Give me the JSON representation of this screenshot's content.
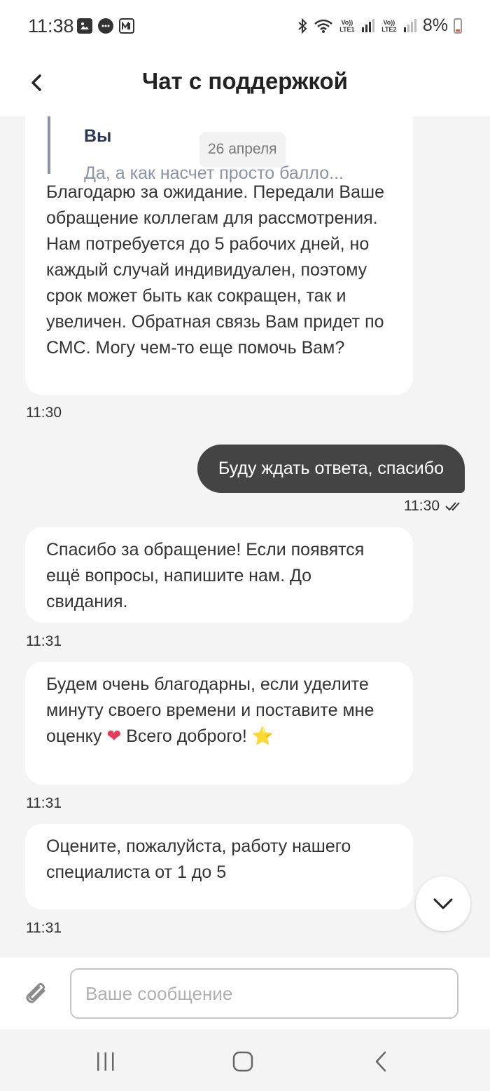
{
  "status_bar": {
    "time": "11:38",
    "net1": "Vo)) LTE1",
    "net2": "Vo)) LTE2",
    "battery": "8%",
    "icons": [
      "gallery-icon",
      "message-icon",
      "magnit-app-icon",
      "bluetooth-icon",
      "wifi-icon",
      "signal-icon",
      "battery-icon"
    ]
  },
  "header": {
    "title": "Чат с поддержкой",
    "back_icon": "chevron-left-icon"
  },
  "chat": {
    "date_chip": "26 апреля",
    "messages": [
      {
        "direction": "incoming",
        "quote_author": "Вы",
        "quote_text": "Да, а как насчет просто балло...",
        "text": "Благодарю за ожидание. Передали Ваше обращение коллегам для рассмотрения. Нам потребуется до 5 рабочих дней, но каждый случай индивидуален, поэтому срок может быть как сокращен, так и увеличен. Обратная связь Вам придет по СМС. Могу чем-то еще помочь Вам?",
        "time": "11:30"
      },
      {
        "direction": "outgoing",
        "text": "Буду ждать ответа, спасибо",
        "time": "11:30",
        "status_icon": "double-check-icon"
      },
      {
        "direction": "incoming",
        "text": "Спасибо за обращение! Если появятся ещё вопросы, напишите нам. До свидания.",
        "time": "11:31"
      },
      {
        "direction": "incoming",
        "text_part1": "Будем очень благодарны, если уделите минуту своего времени и поставите мне оценку",
        "emoji1": "❤",
        "text_part2": "Всего доброго!",
        "emoji2": "⭐",
        "time": "11:31"
      },
      {
        "direction": "incoming",
        "text": "Оцените, пожалуйста, работу нашего специалиста от 1 до 5",
        "time": "11:31"
      }
    ],
    "scroll_icon": "chevron-down-icon"
  },
  "input": {
    "placeholder": "Ваше сообщение",
    "value": "",
    "attach_icon": "paperclip-icon"
  },
  "nav": {
    "icons": [
      "recent-apps-icon",
      "home-icon",
      "back-icon"
    ]
  }
}
